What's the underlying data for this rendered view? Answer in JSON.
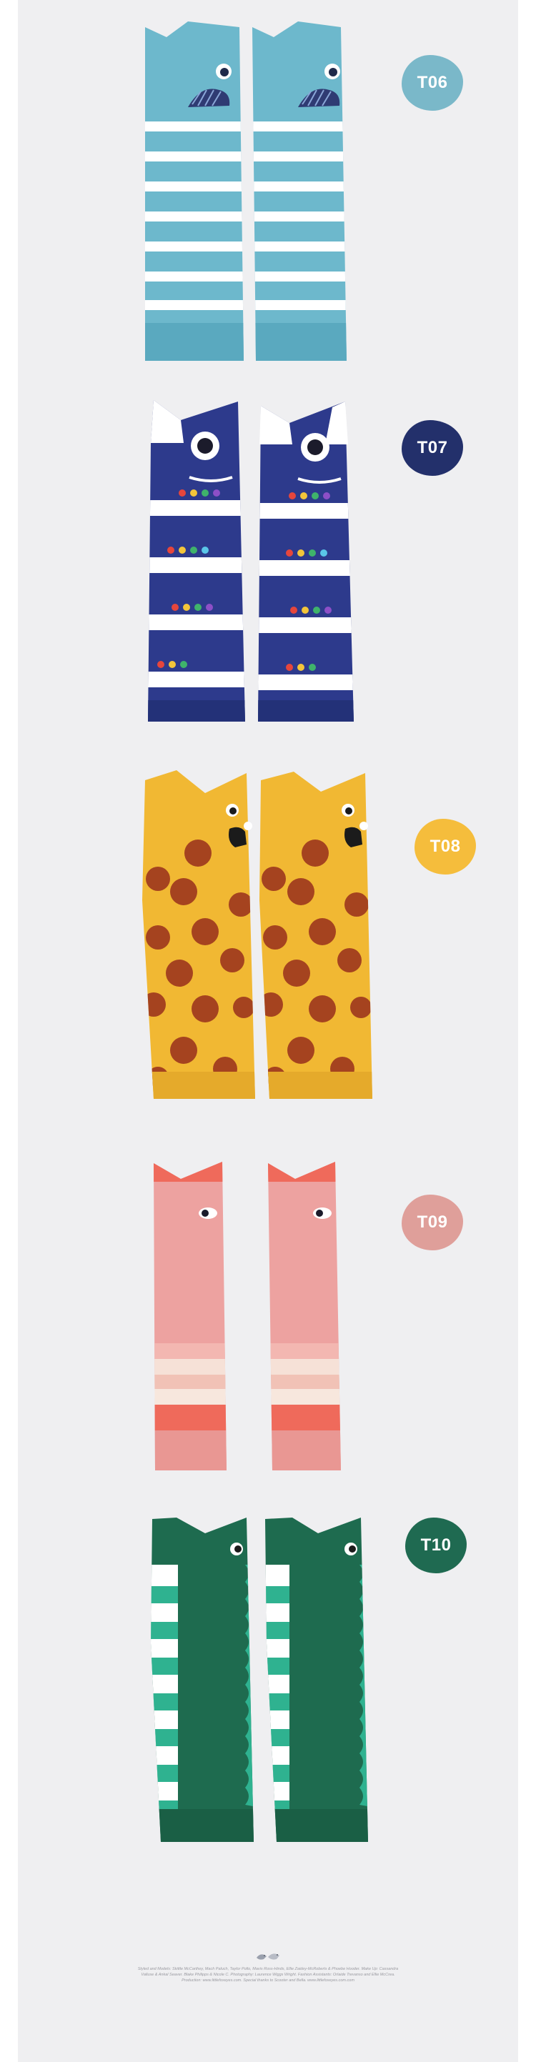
{
  "products": [
    {
      "code": "T06",
      "badge_color": "#7ab8c9"
    },
    {
      "code": "T07",
      "badge_color": "#23306b"
    },
    {
      "code": "T08",
      "badge_color": "#f5bd3c"
    },
    {
      "code": "T09",
      "badge_color": "#df9f9a"
    },
    {
      "code": "T10",
      "badge_color": "#1f6a51"
    }
  ],
  "footer": {
    "text": "Styled and Models: Skittle McCarthey, Mach Paluch, Taylor Pollo, Mavis Ross-Hinds, Ellie Zaidey-McRoberts & Phoebe Hooder. Make Up: Cassandra Valluse & Ankal Seaver. Blake Philipps & Nicole C. Photography: Laurence Wiggs Wright. Fashion Assistants: Orlaide Trevanso and Ellie McCrea. Production: www.littlefoxeyes.com. Special thanks to Scooter and Bella. www.littlefoxeyes.com.com"
  }
}
